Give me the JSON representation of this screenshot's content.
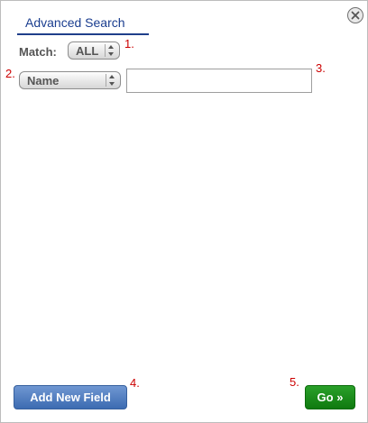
{
  "header": {
    "title": "Advanced Search",
    "close_icon": "close-icon"
  },
  "match": {
    "label": "Match:",
    "selected": "ALL"
  },
  "field_row": {
    "selected_field": "Name",
    "value": ""
  },
  "buttons": {
    "add_new_field": "Add New Field",
    "go": "Go »"
  },
  "annotations": {
    "n1": "1.",
    "n2": "2.",
    "n3": "3.",
    "n4": "4.",
    "n5": "5."
  },
  "colors": {
    "title": "#1a3d8f",
    "annotation": "#cc0000",
    "add_button": "#4a78be",
    "go_button": "#1a8a1a"
  }
}
